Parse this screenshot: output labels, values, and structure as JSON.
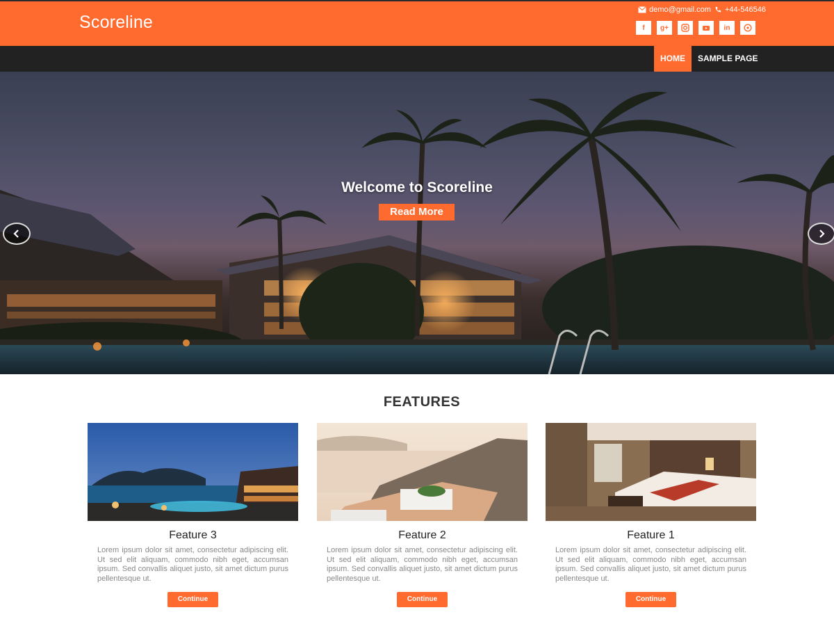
{
  "header": {
    "site_title": "Scoreline",
    "email": "demo@gmail.com",
    "phone": "+44-546546",
    "social": [
      {
        "icon": "facebook-icon",
        "glyph": "f"
      },
      {
        "icon": "google-plus-icon",
        "glyph": "g+"
      },
      {
        "icon": "instagram-icon",
        "glyph": ""
      },
      {
        "icon": "youtube-icon",
        "glyph": ""
      },
      {
        "icon": "linkedin-icon",
        "glyph": "in"
      },
      {
        "icon": "pinterest-icon",
        "glyph": ""
      }
    ]
  },
  "nav": {
    "items": [
      {
        "label": "HOME",
        "active": true
      },
      {
        "label": "SAMPLE PAGE",
        "active": false
      }
    ]
  },
  "hero": {
    "title": "Welcome to Scoreline",
    "button": "Read More"
  },
  "features": {
    "title": "FEATURES",
    "cards": [
      {
        "title": "Feature 3",
        "text": "Lorem ipsum dolor sit amet, consectetur adipiscing elit. Ut sed elit aliquam, commodo nibh eget, accumsan ipsum. Sed convallis aliquet justo, sit amet dictum purus pellentesque ut.",
        "button": "Continue"
      },
      {
        "title": "Feature 2",
        "text": "Lorem ipsum dolor sit amet, consectetur adipiscing elit. Ut sed elit aliquam, commodo nibh eget, accumsan ipsum. Sed convallis aliquet justo, sit amet dictum purus pellentesque ut.",
        "button": "Continue"
      },
      {
        "title": "Feature 1",
        "text": "Lorem ipsum dolor sit amet, consectetur adipiscing elit. Ut sed elit aliquam, commodo nibh eget, accumsan ipsum. Sed convallis aliquet justo, sit amet dictum purus pellentesque ut.",
        "button": "Continue"
      }
    ]
  },
  "colors": {
    "accent": "#ff6a2f",
    "nav_bg": "#222222"
  }
}
